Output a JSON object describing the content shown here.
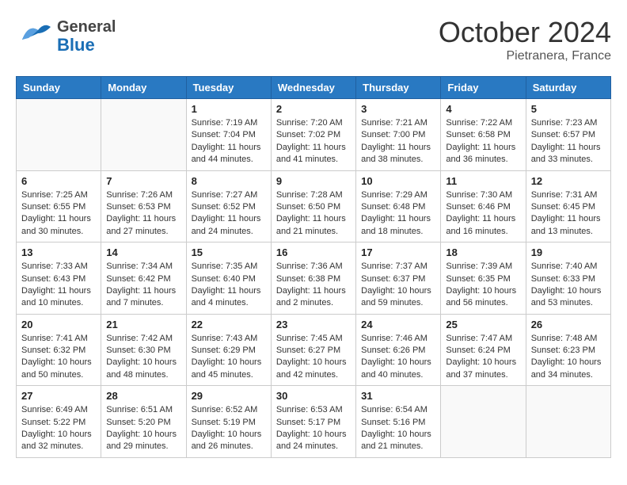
{
  "header": {
    "logo_general": "General",
    "logo_blue": "Blue",
    "month": "October 2024",
    "location": "Pietranera, France"
  },
  "weekdays": [
    "Sunday",
    "Monday",
    "Tuesday",
    "Wednesday",
    "Thursday",
    "Friday",
    "Saturday"
  ],
  "weeks": [
    [
      {
        "day": "",
        "content": ""
      },
      {
        "day": "",
        "content": ""
      },
      {
        "day": "1",
        "content": "Sunrise: 7:19 AM\nSunset: 7:04 PM\nDaylight: 11 hours and 44 minutes."
      },
      {
        "day": "2",
        "content": "Sunrise: 7:20 AM\nSunset: 7:02 PM\nDaylight: 11 hours and 41 minutes."
      },
      {
        "day": "3",
        "content": "Sunrise: 7:21 AM\nSunset: 7:00 PM\nDaylight: 11 hours and 38 minutes."
      },
      {
        "day": "4",
        "content": "Sunrise: 7:22 AM\nSunset: 6:58 PM\nDaylight: 11 hours and 36 minutes."
      },
      {
        "day": "5",
        "content": "Sunrise: 7:23 AM\nSunset: 6:57 PM\nDaylight: 11 hours and 33 minutes."
      }
    ],
    [
      {
        "day": "6",
        "content": "Sunrise: 7:25 AM\nSunset: 6:55 PM\nDaylight: 11 hours and 30 minutes."
      },
      {
        "day": "7",
        "content": "Sunrise: 7:26 AM\nSunset: 6:53 PM\nDaylight: 11 hours and 27 minutes."
      },
      {
        "day": "8",
        "content": "Sunrise: 7:27 AM\nSunset: 6:52 PM\nDaylight: 11 hours and 24 minutes."
      },
      {
        "day": "9",
        "content": "Sunrise: 7:28 AM\nSunset: 6:50 PM\nDaylight: 11 hours and 21 minutes."
      },
      {
        "day": "10",
        "content": "Sunrise: 7:29 AM\nSunset: 6:48 PM\nDaylight: 11 hours and 18 minutes."
      },
      {
        "day": "11",
        "content": "Sunrise: 7:30 AM\nSunset: 6:46 PM\nDaylight: 11 hours and 16 minutes."
      },
      {
        "day": "12",
        "content": "Sunrise: 7:31 AM\nSunset: 6:45 PM\nDaylight: 11 hours and 13 minutes."
      }
    ],
    [
      {
        "day": "13",
        "content": "Sunrise: 7:33 AM\nSunset: 6:43 PM\nDaylight: 11 hours and 10 minutes."
      },
      {
        "day": "14",
        "content": "Sunrise: 7:34 AM\nSunset: 6:42 PM\nDaylight: 11 hours and 7 minutes."
      },
      {
        "day": "15",
        "content": "Sunrise: 7:35 AM\nSunset: 6:40 PM\nDaylight: 11 hours and 4 minutes."
      },
      {
        "day": "16",
        "content": "Sunrise: 7:36 AM\nSunset: 6:38 PM\nDaylight: 11 hours and 2 minutes."
      },
      {
        "day": "17",
        "content": "Sunrise: 7:37 AM\nSunset: 6:37 PM\nDaylight: 10 hours and 59 minutes."
      },
      {
        "day": "18",
        "content": "Sunrise: 7:39 AM\nSunset: 6:35 PM\nDaylight: 10 hours and 56 minutes."
      },
      {
        "day": "19",
        "content": "Sunrise: 7:40 AM\nSunset: 6:33 PM\nDaylight: 10 hours and 53 minutes."
      }
    ],
    [
      {
        "day": "20",
        "content": "Sunrise: 7:41 AM\nSunset: 6:32 PM\nDaylight: 10 hours and 50 minutes."
      },
      {
        "day": "21",
        "content": "Sunrise: 7:42 AM\nSunset: 6:30 PM\nDaylight: 10 hours and 48 minutes."
      },
      {
        "day": "22",
        "content": "Sunrise: 7:43 AM\nSunset: 6:29 PM\nDaylight: 10 hours and 45 minutes."
      },
      {
        "day": "23",
        "content": "Sunrise: 7:45 AM\nSunset: 6:27 PM\nDaylight: 10 hours and 42 minutes."
      },
      {
        "day": "24",
        "content": "Sunrise: 7:46 AM\nSunset: 6:26 PM\nDaylight: 10 hours and 40 minutes."
      },
      {
        "day": "25",
        "content": "Sunrise: 7:47 AM\nSunset: 6:24 PM\nDaylight: 10 hours and 37 minutes."
      },
      {
        "day": "26",
        "content": "Sunrise: 7:48 AM\nSunset: 6:23 PM\nDaylight: 10 hours and 34 minutes."
      }
    ],
    [
      {
        "day": "27",
        "content": "Sunrise: 6:49 AM\nSunset: 5:22 PM\nDaylight: 10 hours and 32 minutes."
      },
      {
        "day": "28",
        "content": "Sunrise: 6:51 AM\nSunset: 5:20 PM\nDaylight: 10 hours and 29 minutes."
      },
      {
        "day": "29",
        "content": "Sunrise: 6:52 AM\nSunset: 5:19 PM\nDaylight: 10 hours and 26 minutes."
      },
      {
        "day": "30",
        "content": "Sunrise: 6:53 AM\nSunset: 5:17 PM\nDaylight: 10 hours and 24 minutes."
      },
      {
        "day": "31",
        "content": "Sunrise: 6:54 AM\nSunset: 5:16 PM\nDaylight: 10 hours and 21 minutes."
      },
      {
        "day": "",
        "content": ""
      },
      {
        "day": "",
        "content": ""
      }
    ]
  ]
}
